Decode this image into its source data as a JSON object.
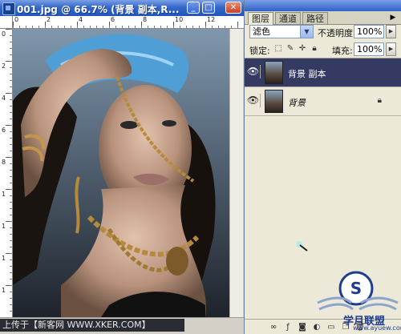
{
  "document": {
    "title": "001.jpg @ 66.7% (背景 副本,R...",
    "minimize_icon": "minimize-icon",
    "maximize_icon": "maximize-icon",
    "close_icon": "close-icon",
    "ruler_h_labels": [
      "0",
      "2",
      "4",
      "6",
      "8",
      "10",
      "12"
    ],
    "ruler_v_labels": [
      "0",
      "2",
      "4",
      "6",
      "8",
      "1",
      "1",
      "1",
      "1"
    ]
  },
  "palette": {
    "tabs": [
      "图层",
      "通道",
      "路径"
    ],
    "blend_mode": "滤色",
    "opacity_label": "不透明度:",
    "opacity_value": "100%",
    "lock_label": "锁定:",
    "fill_label": "填充:",
    "fill_value": "100%",
    "layers": [
      {
        "name": "背景 副本",
        "selected": true,
        "visible": true
      },
      {
        "name": "背景",
        "selected": false,
        "visible": true,
        "locked": true
      }
    ]
  },
  "watermark": {
    "caption": "上传于【新客网 WWW.XKER.COM】",
    "logo_text": "学月联盟",
    "logo_url": "www.ayuew.com"
  }
}
